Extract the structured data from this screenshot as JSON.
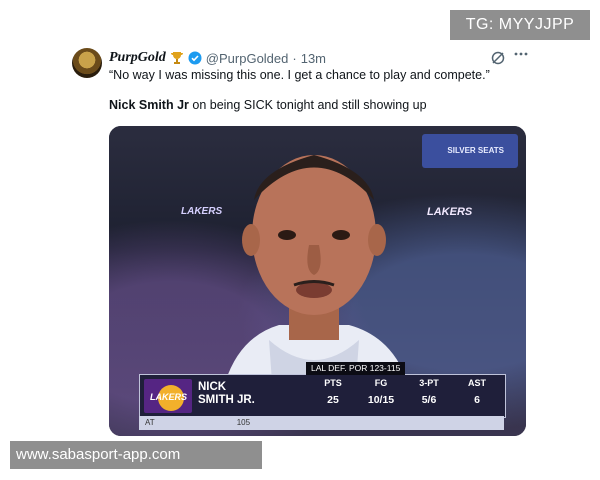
{
  "watermarks": {
    "top": "TG: MYYJJPP",
    "bottom": "www.sabasport-app.com"
  },
  "tweet": {
    "display_name": "PurpGold",
    "handle": "@PurpGolded",
    "separator": "·",
    "time": "13m",
    "text": "“No way I was missing this one. I get a chance to play and compete.”",
    "caption_bold": "Nick Smith Jr",
    "caption_rest": " on being SICK tonight and still showing up",
    "icons": {
      "trophy": "trophy-icon",
      "verified": "verified-badge-icon",
      "grok": "grok-icon",
      "more": "more-icon"
    }
  },
  "media": {
    "arena_banner": "SILVER SEATS",
    "logo_left": "LAKERS",
    "logo_right": "LAKERS",
    "score_header": "LAL DEF. POR 123-115",
    "team_logo_text": "LAKERS",
    "player_first": "NICK",
    "player_last": "SMITH JR.",
    "stats": [
      {
        "label": "PTS",
        "value": "25"
      },
      {
        "label": "FG",
        "value": "10/15"
      },
      {
        "label": "3-PT",
        "value": "5/6"
      },
      {
        "label": "AST",
        "value": "6"
      }
    ],
    "bottom_left": "AT",
    "bottom_mid": "105"
  },
  "colors": {
    "lakers_purple": "#552583",
    "lakers_gold": "#f2b02b",
    "verified_blue": "#1d9bf0"
  }
}
